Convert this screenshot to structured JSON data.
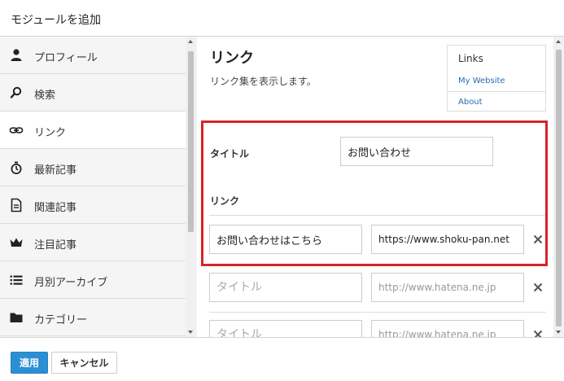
{
  "dialog": {
    "title": "モジュールを追加"
  },
  "sidebar": {
    "items": [
      {
        "label": "プロフィール",
        "icon": "user-icon"
      },
      {
        "label": "検索",
        "icon": "search-icon"
      },
      {
        "label": "リンク",
        "icon": "link-icon",
        "active": true
      },
      {
        "label": "最新記事",
        "icon": "stopwatch-icon"
      },
      {
        "label": "関連記事",
        "icon": "document-icon"
      },
      {
        "label": "注目記事",
        "icon": "crown-icon"
      },
      {
        "label": "月別アーカイブ",
        "icon": "list-icon"
      },
      {
        "label": "カテゴリー",
        "icon": "folder-icon"
      }
    ]
  },
  "module": {
    "title": "リンク",
    "description": "リンク集を表示します。",
    "preview": {
      "title": "Links",
      "links": [
        "My Website",
        "About"
      ]
    },
    "title_field": {
      "label": "タイトル",
      "value": "お問い合わせ"
    },
    "links_label": "リンク",
    "link_rows": [
      {
        "title": "お問い合わせはこちら",
        "url": "https://www.shoku-pan.net",
        "title_placeholder": "",
        "url_placeholder": ""
      },
      {
        "title": "",
        "url": "",
        "title_placeholder": "タイトル",
        "url_placeholder": "http://www.hatena.ne.jp"
      },
      {
        "title": "",
        "url": "",
        "title_placeholder": "タイトル",
        "url_placeholder": "http://www.hatena.ne.jp"
      }
    ]
  },
  "footer": {
    "apply_label": "適用",
    "cancel_label": "キャンセル"
  },
  "colors": {
    "accent": "#2b8fd4",
    "highlight": "#d8232a",
    "link": "#2a6bb5"
  }
}
